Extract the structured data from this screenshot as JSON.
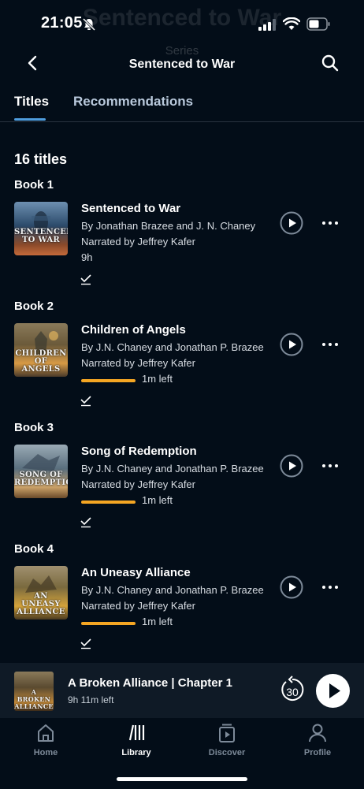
{
  "status_bar": {
    "time": "21:05",
    "ghost_title": "Sentenced to War",
    "ghost_subtitle": "Series"
  },
  "header": {
    "title": "Sentenced to War",
    "back_icon": "chevron-left-icon",
    "search_icon": "search-icon"
  },
  "tabs": [
    {
      "label": "Titles",
      "active": true
    },
    {
      "label": "Recommendations",
      "active": false
    }
  ],
  "count_label": "16 titles",
  "books": [
    {
      "number": "Book 1",
      "title": "Sentenced to War",
      "author": "By Jonathan Brazee and J. N. Chaney",
      "narrator": "Narrated by Jeffrey Kafer",
      "duration": "9h",
      "progress": null,
      "time_left": "",
      "cover_text": "SENTENCED TO WAR",
      "cover_colors": [
        "#2b4a6a",
        "#c46a3a"
      ]
    },
    {
      "number": "Book 2",
      "title": "Children of Angels",
      "author": "By J.N. Chaney and Jonathan P. Brazee",
      "narrator": "Narrated by Jeffrey Kafer",
      "duration": "",
      "progress": 0.98,
      "time_left": "1m left",
      "cover_text": "CHILDREN OF ANGELS",
      "cover_colors": [
        "#6b5a3a",
        "#d79a45"
      ]
    },
    {
      "number": "Book 3",
      "title": "Song of Redemption",
      "author": "By J.N. Chaney and Jonathan P. Brazee",
      "narrator": "Narrated by Jeffrey Kafer",
      "duration": "",
      "progress": 0.98,
      "time_left": "1m left",
      "cover_text": "SONG OF REDEMPTION",
      "cover_colors": [
        "#5a6f7e",
        "#c9a067"
      ]
    },
    {
      "number": "Book 4",
      "title": "An Uneasy Alliance",
      "author": "By J.N. Chaney and Jonathan P. Brazee",
      "narrator": "Narrated by Jeffrey Kafer",
      "duration": "",
      "progress": 0.98,
      "time_left": "1m left",
      "cover_text": "AN UNEASY ALLIANCE",
      "cover_colors": [
        "#7a6a3e",
        "#d4a33b"
      ]
    }
  ],
  "mini_player": {
    "title": "A Broken Alliance | Chapter 1",
    "time_left": "9h 11m left",
    "skip_seconds": "30",
    "cover_text": "A BROKEN ALLIANCE",
    "cover_colors": [
      "#5a4a30",
      "#c38a3a"
    ]
  },
  "nav": [
    {
      "label": "Home",
      "icon": "home-icon",
      "active": false
    },
    {
      "label": "Library",
      "icon": "library-icon",
      "active": true
    },
    {
      "label": "Discover",
      "icon": "discover-icon",
      "active": false
    },
    {
      "label": "Profile",
      "icon": "profile-icon",
      "active": false
    }
  ],
  "colors": {
    "background": "#030d18",
    "accent": "#4f9dde",
    "progress": "#f5a623"
  }
}
